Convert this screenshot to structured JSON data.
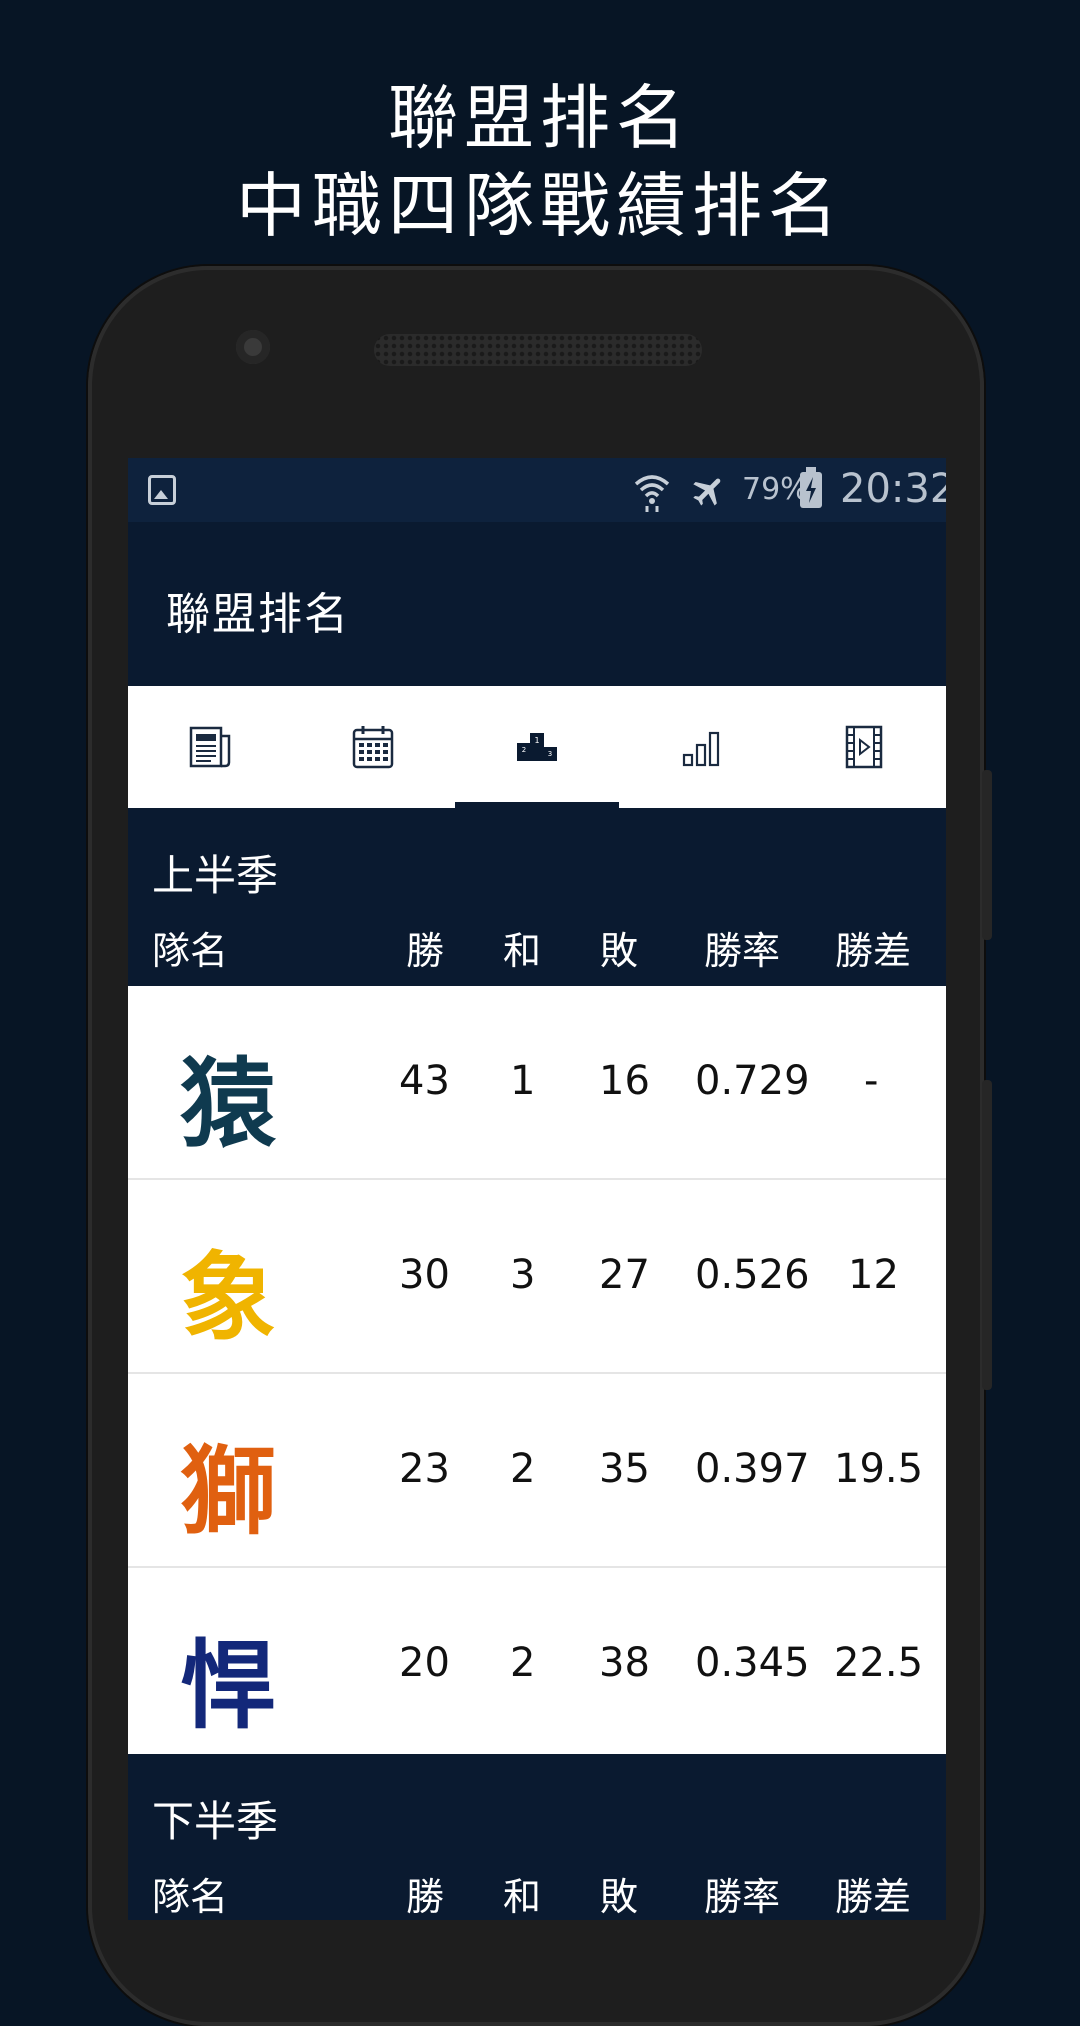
{
  "promo": {
    "line1": "聯盟排名",
    "line2": "中職四隊戰績排名"
  },
  "status_bar": {
    "battery": "79%",
    "time": "20:32",
    "icons": [
      "image-icon",
      "wifi-icon",
      "airplane-mode-icon",
      "battery-charging-icon"
    ]
  },
  "app_bar": {
    "title": "聯盟排名"
  },
  "tabs": [
    {
      "icon": "news-icon",
      "active": false
    },
    {
      "icon": "calendar-icon",
      "active": false
    },
    {
      "icon": "podium-icon",
      "active": true
    },
    {
      "icon": "bar-chart-icon",
      "active": false
    },
    {
      "icon": "video-icon",
      "active": false
    }
  ],
  "first_half": {
    "season": "上半季",
    "headers": {
      "team": "隊名",
      "wins": "勝",
      "ties": "和",
      "losses": "敗",
      "win_rate": "勝率",
      "games_behind": "勝差"
    },
    "rows": [
      {
        "team": "猿",
        "team_color": "#0f3a4f",
        "wins": "43",
        "ties": "1",
        "losses": "16",
        "win_rate": "0.729",
        "games_behind": "-"
      },
      {
        "team": "象",
        "team_color": "#f0b400",
        "wins": "30",
        "ties": "3",
        "losses": "27",
        "win_rate": "0.526",
        "games_behind": "12"
      },
      {
        "team": "獅",
        "team_color": "#e06010",
        "wins": "23",
        "ties": "2",
        "losses": "35",
        "win_rate": "0.397",
        "games_behind": "19.5"
      },
      {
        "team": "悍",
        "team_color": "#13287a",
        "wins": "20",
        "ties": "2",
        "losses": "38",
        "win_rate": "0.345",
        "games_behind": "22.5"
      }
    ]
  },
  "second_half": {
    "season": "下半季",
    "headers": {
      "team": "隊名",
      "wins": "勝",
      "ties": "和",
      "losses": "敗",
      "win_rate": "勝率",
      "games_behind": "勝差"
    }
  },
  "colors": {
    "background": "#071525",
    "header_navy": "#0a1a30",
    "status_bar": "#0e223d"
  }
}
